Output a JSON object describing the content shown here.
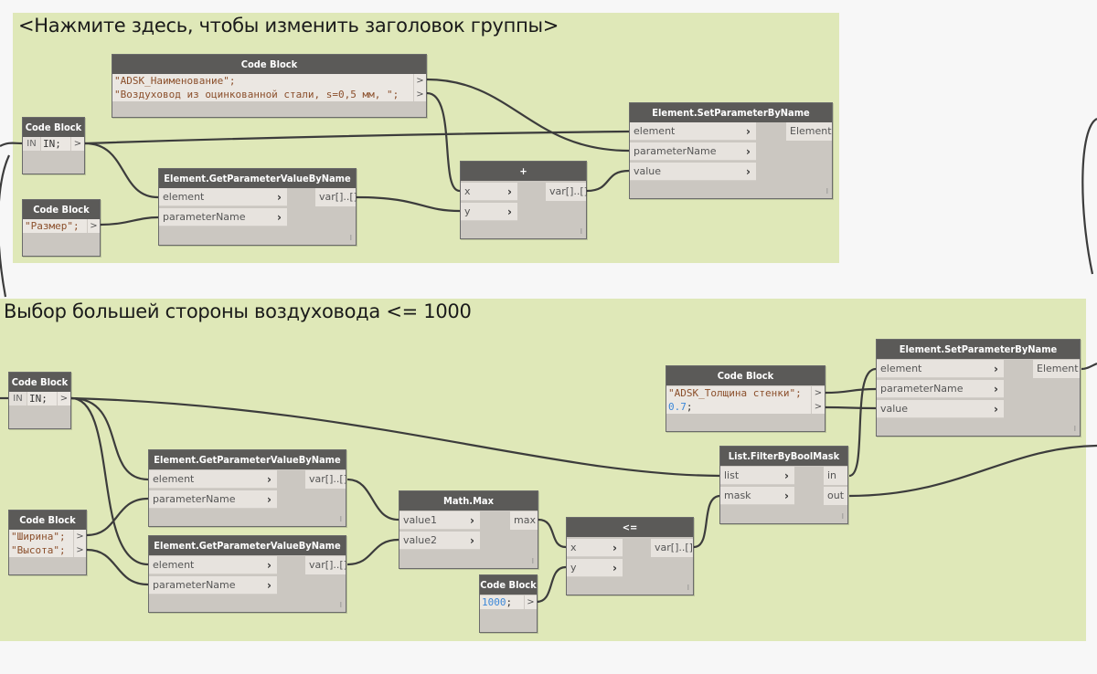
{
  "groups": [
    {
      "title": "<Нажмите здесь, чтобы изменить заголовок группы>",
      "color": "#dfe8b8"
    },
    {
      "title": "Выбор большей стороны воздуховода <= 1000",
      "color": "#dfe8b8"
    }
  ],
  "nodes": {
    "cb_names": {
      "title": "Code Block",
      "lines": [
        "\"ADSK_Наименование\";",
        "\"Воздуховод из оцинкованной стали, s=0,5 мм, \";"
      ],
      "outputs": [
        ">",
        ">"
      ]
    },
    "cb_in_1": {
      "title": "Code Block",
      "input": "IN",
      "lines": [
        "IN;"
      ],
      "outputs": [
        ">"
      ]
    },
    "cb_size": {
      "title": "Code Block",
      "lines": [
        "\"Размер\";"
      ],
      "outputs": [
        ">"
      ]
    },
    "get_param_1": {
      "title": "Element.GetParameterValueByName",
      "inputs": [
        "element",
        "parameterName"
      ],
      "outputs": [
        "var[]..[]"
      ]
    },
    "plus": {
      "title": "+",
      "inputs": [
        "x",
        "y"
      ],
      "outputs": [
        "var[]..[]"
      ]
    },
    "set_param_1": {
      "title": "Element.SetParameterByName",
      "inputs": [
        "element",
        "parameterName",
        "value"
      ],
      "outputs": [
        "Element"
      ]
    },
    "cb_in_2": {
      "title": "Code Block",
      "input": "IN",
      "lines": [
        "IN;"
      ],
      "outputs": [
        ">"
      ]
    },
    "cb_wh": {
      "title": "Code Block",
      "lines": [
        "\"Ширина\";",
        "\"Высота\";"
      ],
      "outputs": [
        ">",
        ">"
      ]
    },
    "get_param_2": {
      "title": "Element.GetParameterValueByName",
      "inputs": [
        "element",
        "parameterName"
      ],
      "outputs": [
        "var[]..[]"
      ]
    },
    "get_param_3": {
      "title": "Element.GetParameterValueByName",
      "inputs": [
        "element",
        "parameterName"
      ],
      "outputs": [
        "var[]..[]"
      ]
    },
    "math_max": {
      "title": "Math.Max",
      "inputs": [
        "value1",
        "value2"
      ],
      "outputs": [
        "max"
      ]
    },
    "cb_1000": {
      "title": "Code Block",
      "lines_num": "1000",
      "outputs": [
        ">"
      ]
    },
    "lte": {
      "title": "<=",
      "inputs": [
        "x",
        "y"
      ],
      "outputs": [
        "var[]..[]"
      ]
    },
    "cb_thick": {
      "title": "Code Block",
      "lines": [
        "\"ADSK_Толщина стенки\";"
      ],
      "lines_num": "0.7",
      "outputs": [
        ">",
        ">"
      ]
    },
    "filter": {
      "title": "List.FilterByBoolMask",
      "inputs": [
        "list",
        "mask"
      ],
      "outputs": [
        "in",
        "out"
      ]
    },
    "set_param_2": {
      "title": "Element.SetParameterByName",
      "inputs": [
        "element",
        "parameterName",
        "value"
      ],
      "outputs": [
        "Element"
      ]
    }
  },
  "semicolon": ";",
  "chevron": "›",
  "lacing": "l"
}
